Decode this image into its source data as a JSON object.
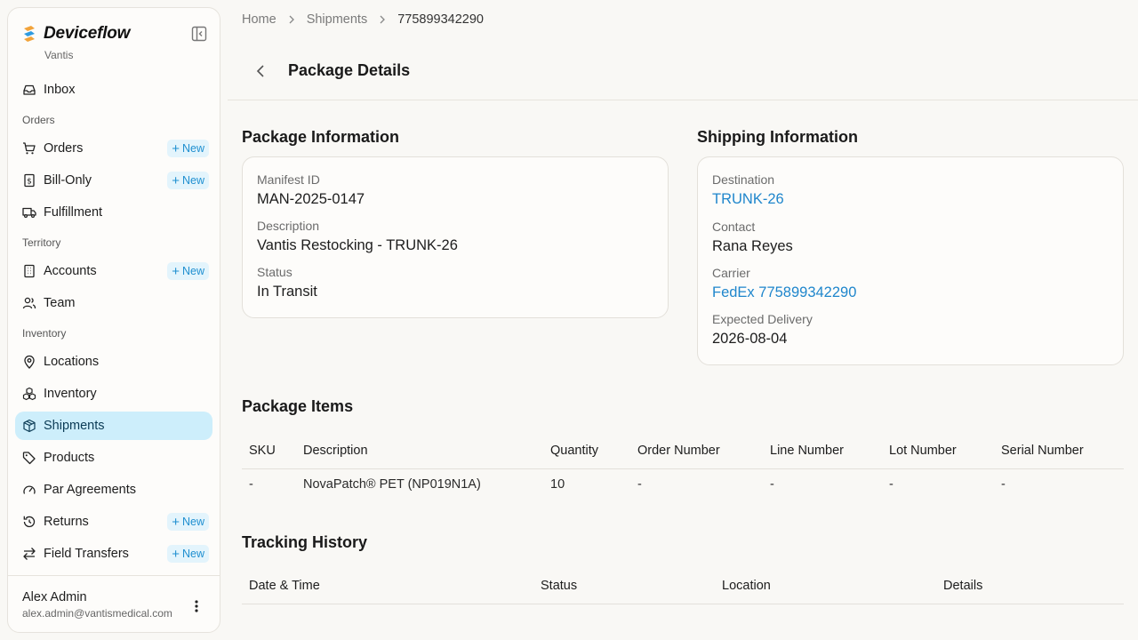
{
  "sidebar": {
    "brand_name": "Deviceflow",
    "brand_sub": "Vantis",
    "new_label": "New",
    "items": {
      "inbox": "Inbox",
      "orders_section": "Orders",
      "orders": "Orders",
      "bill_only": "Bill-Only",
      "fulfillment": "Fulfillment",
      "territory_section": "Territory",
      "accounts": "Accounts",
      "team": "Team",
      "inventory_section": "Inventory",
      "locations": "Locations",
      "inventory": "Inventory",
      "shipments": "Shipments",
      "products": "Products",
      "par_agreements": "Par Agreements",
      "returns": "Returns",
      "field_transfers": "Field Transfers"
    },
    "user": {
      "name": "Alex Admin",
      "email": "alex.admin@vantismedical.com"
    }
  },
  "breadcrumb": {
    "home": "Home",
    "shipments": "Shipments",
    "current": "775899342290"
  },
  "page_title": "Package Details",
  "package_info": {
    "title": "Package Information",
    "manifest_label": "Manifest ID",
    "manifest_value": "MAN-2025-0147",
    "description_label": "Description",
    "description_value": "Vantis Restocking - TRUNK-26",
    "status_label": "Status",
    "status_value": "In Transit"
  },
  "shipping_info": {
    "title": "Shipping Information",
    "destination_label": "Destination",
    "destination_value": "TRUNK-26",
    "contact_label": "Contact",
    "contact_value": "Rana Reyes",
    "carrier_label": "Carrier",
    "carrier_value": "FedEx 775899342290",
    "delivery_label": "Expected Delivery",
    "delivery_value": "2026-08-04"
  },
  "package_items": {
    "title": "Package Items",
    "headers": [
      "SKU",
      "Description",
      "Quantity",
      "Order Number",
      "Line Number",
      "Lot Number",
      "Serial Number"
    ],
    "rows": [
      [
        "-",
        "NovaPatch® PET (NP019N1A)",
        "10",
        "-",
        "-",
        "-",
        "-"
      ]
    ]
  },
  "tracking_history": {
    "title": "Tracking History",
    "headers": [
      "Date & Time",
      "Status",
      "Location",
      "Details"
    ]
  },
  "colors": {
    "accent": "#1f86cc",
    "active_bg": "#cdeefb",
    "badge_bg": "#e3f4fc",
    "page_bg": "#f9f8f5"
  }
}
